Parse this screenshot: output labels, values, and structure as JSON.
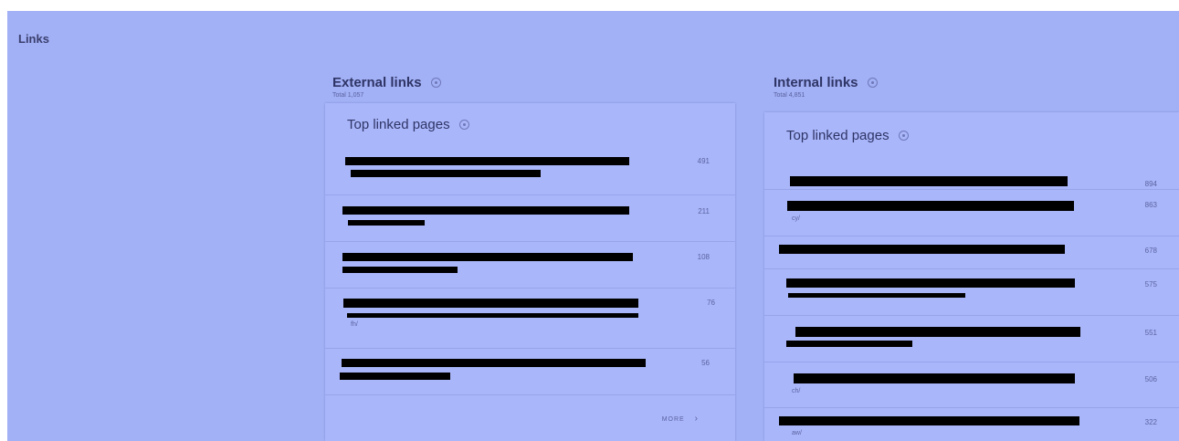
{
  "page": {
    "title": "Links"
  },
  "external": {
    "title": "External links",
    "total": "Total 1,057",
    "card_title": "Top linked pages",
    "rows": [
      {
        "count": "491",
        "suffix": ""
      },
      {
        "count": "211",
        "suffix": ""
      },
      {
        "count": "108",
        "suffix": ""
      },
      {
        "count": "76",
        "suffix": "fh/"
      },
      {
        "count": "56",
        "suffix": ""
      }
    ],
    "more_label": "MORE",
    "more_arrow": "›"
  },
  "internal": {
    "title": "Internal links",
    "total": "Total 4,851",
    "card_title": "Top linked pages",
    "rows": [
      {
        "count": "894",
        "suffix": ""
      },
      {
        "count": "863",
        "suffix": "cy/"
      },
      {
        "count": "678",
        "suffix": ""
      },
      {
        "count": "575",
        "suffix": ""
      },
      {
        "count": "551",
        "suffix": ""
      },
      {
        "count": "506",
        "suffix": "ch/"
      },
      {
        "count": "322",
        "suffix": "aw/"
      }
    ]
  },
  "colors": {
    "background": "#a2b0f5",
    "card": "#a9b6fa",
    "redaction": "#000000"
  }
}
